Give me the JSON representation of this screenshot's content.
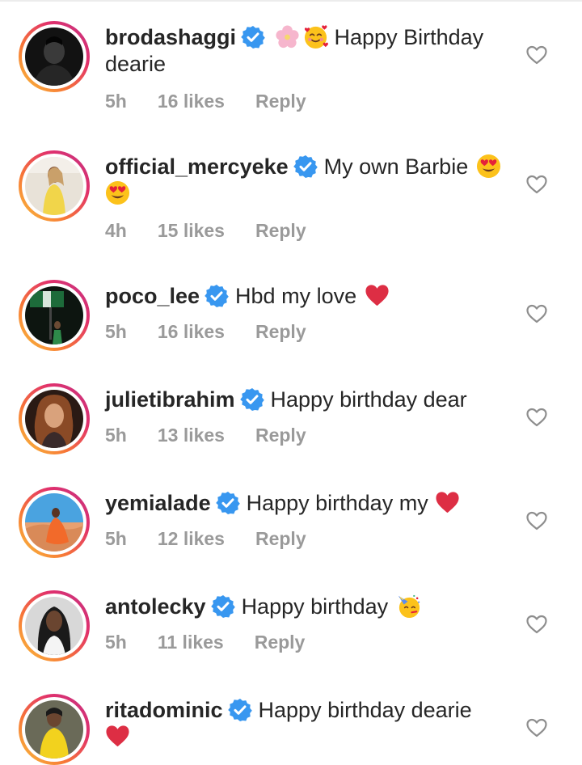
{
  "comments": [
    {
      "username": "brodashaggi",
      "verified": true,
      "text": "Happy Birthday dearie",
      "text_line1": "Happy Birthday",
      "text_line2": "dearie",
      "emojis_before": [
        "cherry-blossom",
        "smiling-face-with-hearts"
      ],
      "time": "5h",
      "likes": "16 likes",
      "reply": "Reply"
    },
    {
      "username": "official_mercyeke",
      "verified": true,
      "text": "My own Barbie",
      "emojis_after": [
        "heart-eyes",
        "heart-eyes"
      ],
      "time": "4h",
      "likes": "15 likes",
      "reply": "Reply"
    },
    {
      "username": "poco_lee",
      "verified": true,
      "text": "Hbd my love",
      "emojis_after": [
        "red-heart"
      ],
      "time": "5h",
      "likes": "16 likes",
      "reply": "Reply"
    },
    {
      "username": "julietibrahim",
      "verified": true,
      "text": "Happy birthday dear",
      "time": "5h",
      "likes": "13 likes",
      "reply": "Reply"
    },
    {
      "username": "yemialade",
      "verified": true,
      "text": "Happy birthday my",
      "emojis_after": [
        "red-heart"
      ],
      "time": "5h",
      "likes": "12 likes",
      "reply": "Reply"
    },
    {
      "username": "antolecky",
      "verified": true,
      "text": "Happy birthday",
      "emojis_after": [
        "partying-face"
      ],
      "time": "5h",
      "likes": "11 likes",
      "reply": "Reply"
    },
    {
      "username": "ritadominic",
      "verified": true,
      "text": "Happy birthday dearie",
      "emojis_after": [
        "red-heart"
      ]
    }
  ],
  "colors": {
    "username": "#262626",
    "meta": "#9a9a9a",
    "verified_badge": "#3897f0",
    "story_ring": [
      "#f9c33c",
      "#f77737",
      "#e1306c",
      "#c13584"
    ]
  }
}
